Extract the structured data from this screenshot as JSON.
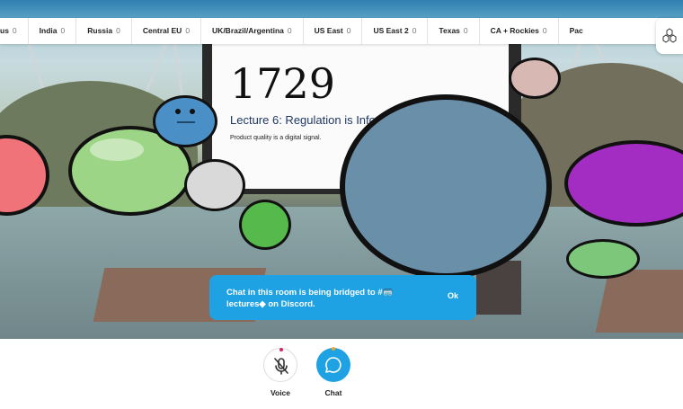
{
  "regions": [
    {
      "name": "us",
      "count": "0"
    },
    {
      "name": "India",
      "count": "0"
    },
    {
      "name": "Russia",
      "count": "0"
    },
    {
      "name": "Central EU",
      "count": "0"
    },
    {
      "name": "UK/Brazil/Argentina",
      "count": "0"
    },
    {
      "name": "US East",
      "count": "0"
    },
    {
      "name": "US East 2",
      "count": "0"
    },
    {
      "name": "Texas",
      "count": "0"
    },
    {
      "name": "CA + Rockies",
      "count": "0"
    },
    {
      "name": "Pac",
      "count": ""
    }
  ],
  "slide": {
    "number": "1729",
    "title": "Lecture 6: Regulation is Infor",
    "subtitle": "Product quality is a digital signal."
  },
  "toast": {
    "message": "Chat in this room is being bridged to #🥽 lectures◆ on Discord.",
    "ok_label": "Ok"
  },
  "controls": {
    "voice_label": "Voice",
    "chat_label": "Chat"
  },
  "colors": {
    "accent": "#1ea2e4",
    "voice_dot": "#e0245e",
    "chat_dot": "#f5a623"
  },
  "icons": {
    "region_settings": "hexagons-icon",
    "voice": "mic-muted-icon",
    "chat": "chat-bubble-icon"
  }
}
